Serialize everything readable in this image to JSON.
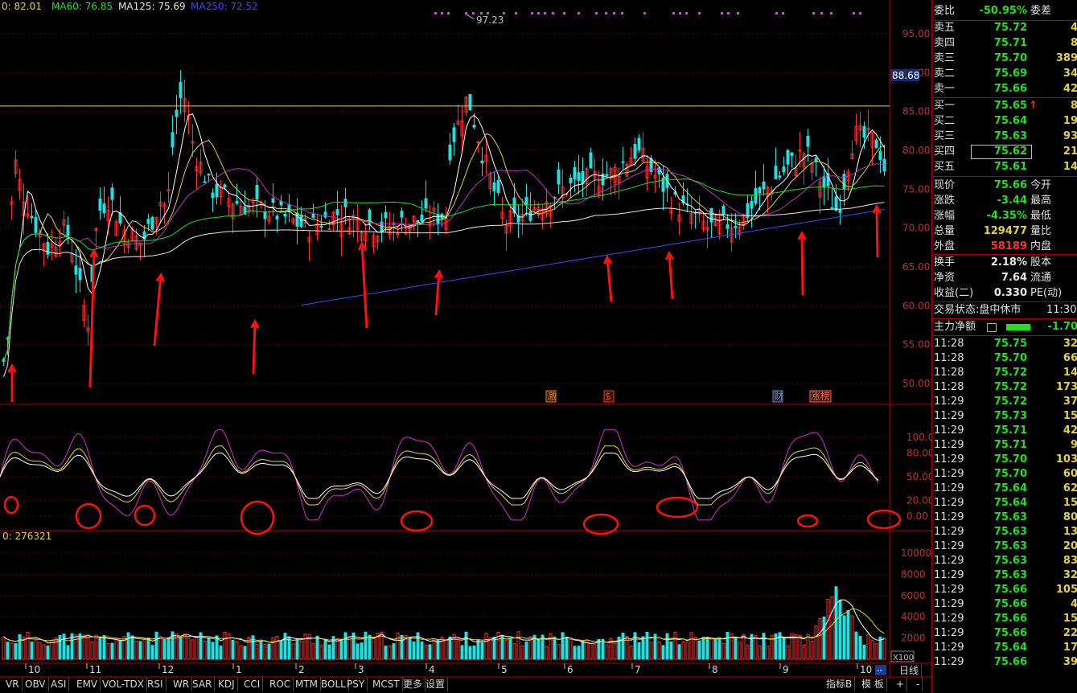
{
  "ma_header": [
    {
      "text": "0: 82.01",
      "color": "#e6d33c"
    },
    {
      "text": "MA60: 76.85",
      "color": "#20e020"
    },
    {
      "text": "MA125: 75.69",
      "color": "#e8e8e8"
    },
    {
      "text": "MA250: 72.52",
      "color": "#3a4bff"
    }
  ],
  "high_label": "97.23",
  "current_price_tag": "88.68",
  "price_axis": [
    "95.00",
    "90.00",
    "85.00",
    "80.00",
    "75.00",
    "70.00",
    "65.00",
    "60.00",
    "55.00",
    "50.00"
  ],
  "kdj_axis": [
    "100.00",
    "80.00",
    "50.00",
    "20.00",
    "0.00"
  ],
  "vol_header": "0: 276321",
  "vol_axis": [
    "10000",
    "8000",
    "6000",
    "4000",
    "2000"
  ],
  "vol_unit": "X100",
  "months": [
    "10",
    "11",
    "12",
    "1",
    "2",
    "3",
    "4",
    "5",
    "6",
    "7",
    "8",
    "9",
    "10"
  ],
  "markers": [
    {
      "text": "激",
      "color": "#e07a30"
    },
    {
      "text": "$",
      "color": "#ff3030"
    },
    {
      "text": "财",
      "color": "#4a8aff"
    },
    {
      "text": "涨榜",
      "color": "#ff6060"
    }
  ],
  "bottom_tabs": [
    "VR",
    "OBV",
    "ASI",
    "EMV",
    "VOL-TDX",
    "RSI",
    "WR",
    "SAR",
    "KDJ",
    "CCI",
    "ROC",
    "MTM",
    "BOLL",
    "PSY",
    "MCST",
    "更多",
    "设置"
  ],
  "bottom_right_tabs": [
    "指标B",
    "模 板",
    "+",
    "-"
  ],
  "period_label": "日线",
  "order_book": {
    "ratio_label": "委比",
    "ratio_value": "-50.95%",
    "diff_label": "委差",
    "asks": [
      {
        "label": "卖五",
        "price": "75.72",
        "qty": "4"
      },
      {
        "label": "卖四",
        "price": "75.71",
        "qty": "8"
      },
      {
        "label": "卖三",
        "price": "75.70",
        "qty": "389"
      },
      {
        "label": "卖二",
        "price": "75.69",
        "qty": "34"
      },
      {
        "label": "卖一",
        "price": "75.66",
        "qty": "42"
      }
    ],
    "bids": [
      {
        "label": "买一",
        "price": "75.65",
        "qty": "8",
        "arrow": "↑"
      },
      {
        "label": "买二",
        "price": "75.64",
        "qty": "19",
        "arrow": ""
      },
      {
        "label": "买三",
        "price": "75.63",
        "qty": "93",
        "arrow": ""
      },
      {
        "label": "买四",
        "price": "75.62",
        "qty": "21",
        "arrow": ""
      },
      {
        "label": "买五",
        "price": "75.61",
        "qty": "14",
        "arrow": ""
      }
    ]
  },
  "quote": [
    {
      "label": "现价",
      "value": "75.66",
      "color": "#20e020",
      "right": "今开"
    },
    {
      "label": "涨跌",
      "value": "-3.44",
      "color": "#20e020",
      "right": "最高"
    },
    {
      "label": "涨幅",
      "value": "-4.35%",
      "color": "#20e020",
      "right": "最低"
    },
    {
      "label": "总量",
      "value": "129477",
      "color": "#e6d33c",
      "right": "量比"
    },
    {
      "label": "外盘",
      "value": "58189",
      "color": "#ff3030",
      "right": "内盘"
    }
  ],
  "stats": [
    {
      "label": "换手",
      "value": "2.18%",
      "right": "股本"
    },
    {
      "label": "净资",
      "value": "7.64",
      "right": "流通"
    },
    {
      "label": "收益(二)",
      "value": "0.330",
      "right": "PE(动)"
    }
  ],
  "trade_status": {
    "label": "交易状态:",
    "value": "盘中休市",
    "time": "11:30"
  },
  "main_flow": {
    "label": "主力净额",
    "value": "-1.70"
  },
  "ticks": [
    {
      "time": "11:28",
      "price": "75.75",
      "qty": "32",
      "color": "#20e020"
    },
    {
      "time": "11:28",
      "price": "75.70",
      "qty": "66",
      "color": "#20e020"
    },
    {
      "time": "11:28",
      "price": "75.72",
      "qty": "14",
      "color": "#20e020"
    },
    {
      "time": "11:28",
      "price": "75.72",
      "qty": "173",
      "color": "#20e020"
    },
    {
      "time": "11:29",
      "price": "75.72",
      "qty": "37",
      "color": "#20e020"
    },
    {
      "time": "11:29",
      "price": "75.73",
      "qty": "15",
      "color": "#20e020"
    },
    {
      "time": "11:29",
      "price": "75.71",
      "qty": "42",
      "color": "#20e020"
    },
    {
      "time": "11:29",
      "price": "75.71",
      "qty": "9",
      "color": "#20e020"
    },
    {
      "time": "11:29",
      "price": "75.70",
      "qty": "103",
      "color": "#20e020"
    },
    {
      "time": "11:29",
      "price": "75.70",
      "qty": "60",
      "color": "#20e020"
    },
    {
      "time": "11:29",
      "price": "75.64",
      "qty": "62",
      "color": "#20e020"
    },
    {
      "time": "11:29",
      "price": "75.64",
      "qty": "15",
      "color": "#20e020"
    },
    {
      "time": "11:29",
      "price": "75.63",
      "qty": "80",
      "color": "#20e020"
    },
    {
      "time": "11:29",
      "price": "75.63",
      "qty": "13",
      "color": "#20e020"
    },
    {
      "time": "11:29",
      "price": "75.63",
      "qty": "20",
      "color": "#20e020"
    },
    {
      "time": "11:29",
      "price": "75.63",
      "qty": "83",
      "color": "#20e020"
    },
    {
      "time": "11:29",
      "price": "75.63",
      "qty": "32",
      "color": "#20e020"
    },
    {
      "time": "11:29",
      "price": "75.66",
      "qty": "105",
      "color": "#20e020"
    },
    {
      "time": "11:29",
      "price": "75.66",
      "qty": "4",
      "color": "#20e020"
    },
    {
      "time": "11:29",
      "price": "75.66",
      "qty": "15",
      "color": "#20e020"
    },
    {
      "time": "11:29",
      "price": "75.66",
      "qty": "22",
      "color": "#20e020"
    },
    {
      "time": "11:29",
      "price": "75.64",
      "qty": "17",
      "color": "#20e020"
    },
    {
      "time": "11:29",
      "price": "75.66",
      "qty": "39",
      "color": "#20e020"
    }
  ],
  "colors": {
    "up": "#ff3030",
    "down": "#20e0e0",
    "grid": "#b40000",
    "ma_short": "#ffffff",
    "ma_yellow": "#e6d33c",
    "ma_purple": "#c030c0",
    "ma_green": "#20e020",
    "ma_blue": "#3a4bff"
  }
}
